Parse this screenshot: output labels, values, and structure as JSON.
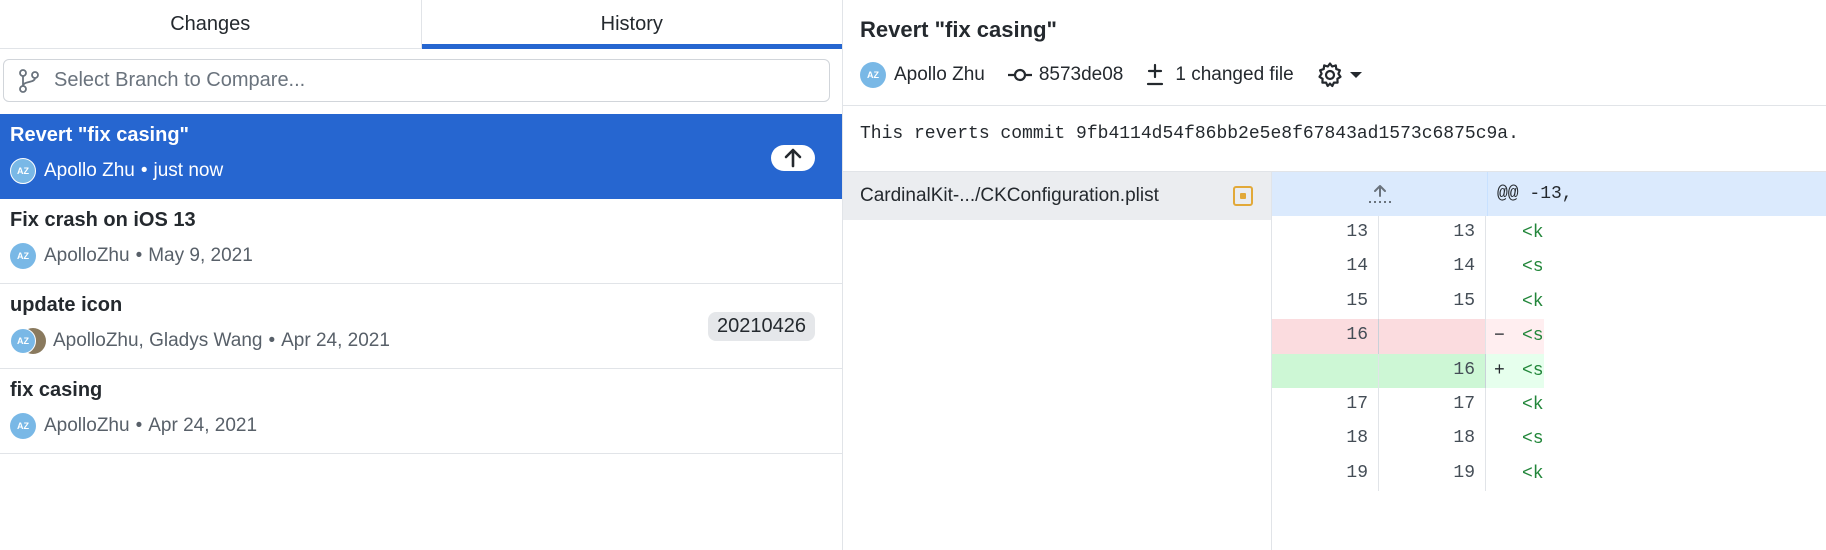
{
  "tabs": {
    "changes": "Changes",
    "history": "History"
  },
  "branch_compare": {
    "placeholder": "Select Branch to Compare..."
  },
  "commits": [
    {
      "summary": "Revert \"fix casing\"",
      "author": "Apollo Zhu",
      "separator": "•",
      "date": "just now",
      "avatar_initials": "AZ",
      "badge": "push-arrow"
    },
    {
      "summary": "Fix crash on iOS 13",
      "author": "ApolloZhu",
      "separator": "•",
      "date": "May 9, 2021",
      "avatar_initials": "AZ"
    },
    {
      "summary": "update icon",
      "author": "ApolloZhu, Gladys Wang",
      "separator": "•",
      "date": "Apr 24, 2021",
      "avatar_initials": "AZ",
      "tag": "20210426"
    },
    {
      "summary": "fix casing",
      "author": "ApolloZhu",
      "separator": "•",
      "date": "Apr 24, 2021",
      "avatar_initials": "AZ"
    }
  ],
  "detail": {
    "title": "Revert \"fix casing\"",
    "author": "Apollo Zhu",
    "avatar_initials": "AZ",
    "sha": "8573de08",
    "changed_files": "1 changed file",
    "description": "This reverts commit 9fb4114d54f86bb2e5e8f67843ad1573c6875c9a."
  },
  "files": [
    {
      "path": "CardinalKit-.../CKConfiguration.plist",
      "status": "modified"
    }
  ],
  "diff": {
    "hunk_header": "@@ -13,",
    "lines": [
      {
        "old": "13",
        "new": "13",
        "marker": "",
        "code": "<k",
        "type": "context"
      },
      {
        "old": "14",
        "new": "14",
        "marker": "",
        "code": "<s",
        "type": "context"
      },
      {
        "old": "15",
        "new": "15",
        "marker": "",
        "code": "<k",
        "type": "context"
      },
      {
        "old": "16",
        "new": "",
        "marker": "−",
        "code": "<s",
        "type": "del"
      },
      {
        "old": "",
        "new": "16",
        "marker": "+",
        "code": "<s",
        "type": "add"
      },
      {
        "old": "17",
        "new": "17",
        "marker": "",
        "code": "<k",
        "type": "context"
      },
      {
        "old": "18",
        "new": "18",
        "marker": "",
        "code": "<s",
        "type": "context"
      },
      {
        "old": "19",
        "new": "19",
        "marker": "",
        "code": "<k",
        "type": "context"
      }
    ]
  },
  "colors": {
    "accent": "#2666d0",
    "avatar": "#79b8e6",
    "deleted_bg": "#ffeef0",
    "added_bg": "#e6ffed",
    "modified_status": "#e2a939",
    "code_green": "#22863a"
  }
}
